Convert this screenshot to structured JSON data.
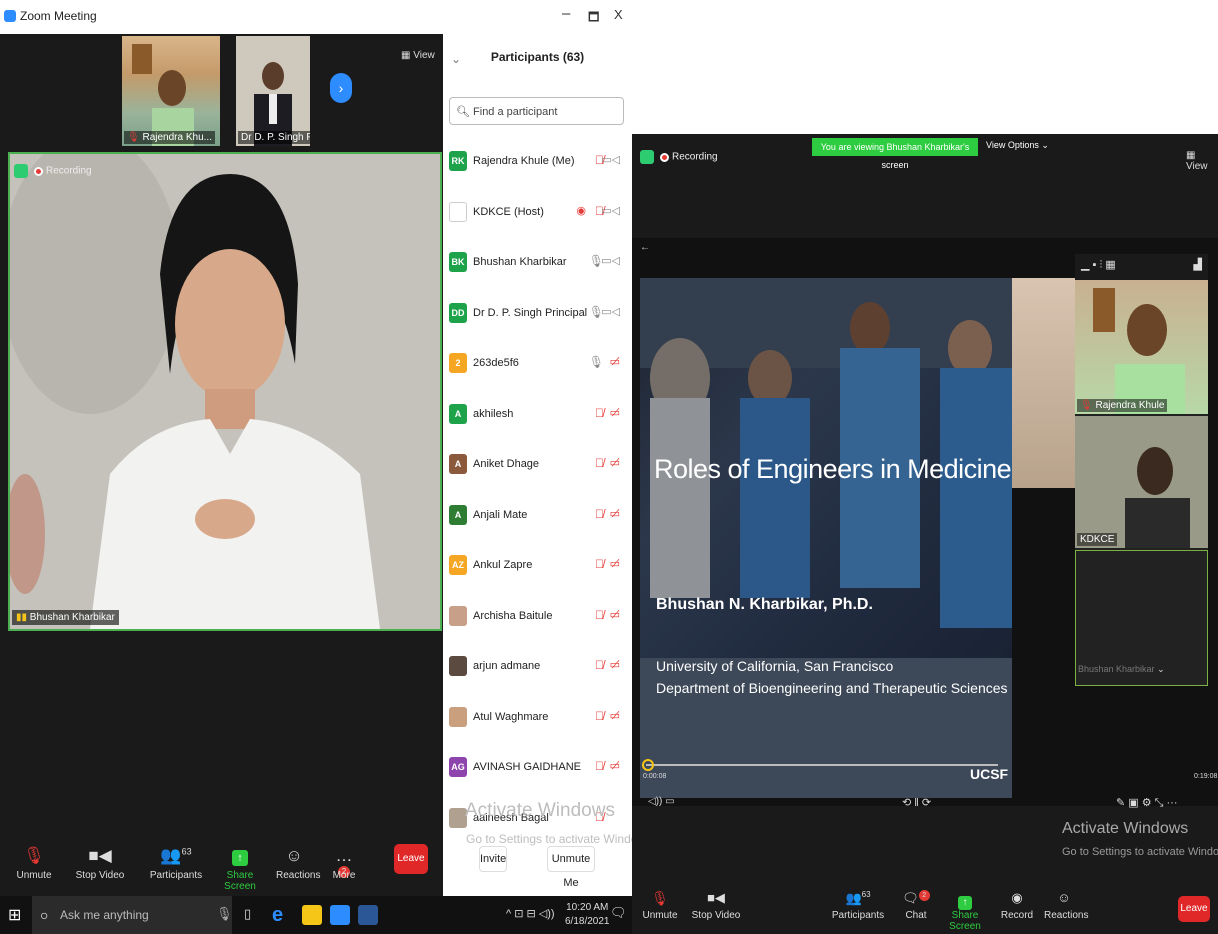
{
  "window": {
    "title": "Zoom Meeting",
    "minimize": "–",
    "maximize": "🗖",
    "close": "X"
  },
  "strip": {
    "thumbs": [
      {
        "label": "Rajendra Khu..."
      },
      {
        "label": "Dr D. P. Singh Pr..."
      }
    ],
    "next": "›",
    "view": "View"
  },
  "main_video": {
    "label": "Bhushan Kharbikar",
    "recording": "Recording"
  },
  "participants": {
    "header": "Participants (63)",
    "search_placeholder": "Find a participant",
    "rows": [
      {
        "initials": "RK",
        "color": "#1fa34a",
        "name": "Rajendra Khule (Me)",
        "mic": "muted",
        "cam": "on"
      },
      {
        "initials": "",
        "color": "#ffffff",
        "name": "KDKCE (Host)",
        "mic": "muted",
        "cam": "on",
        "rec": true
      },
      {
        "initials": "BK",
        "color": "#1fa34a",
        "name": "Bhushan Kharbikar",
        "mic": "on",
        "cam": "on"
      },
      {
        "initials": "DD",
        "color": "#1fa34a",
        "name": "Dr D. P. Singh Principal",
        "mic": "on",
        "cam": "on"
      },
      {
        "initials": "2",
        "color": "#f5a623",
        "name": "263de5f6",
        "mic": "on",
        "cam": "off"
      },
      {
        "initials": "A",
        "color": "#1fa34a",
        "name": "akhilesh",
        "mic": "muted",
        "cam": "off"
      },
      {
        "initials": "A",
        "color": "#8b5a3c",
        "name": "Aniket Dhage",
        "mic": "muted",
        "cam": "off"
      },
      {
        "initials": "A",
        "color": "#2e7d32",
        "name": "Anjali Mate",
        "mic": "muted",
        "cam": "off"
      },
      {
        "initials": "AZ",
        "color": "#f5a623",
        "name": "Ankul Zapre",
        "mic": "muted",
        "cam": "off"
      },
      {
        "initials": "",
        "color": "#c8a08a",
        "name": "Archisha Baitule",
        "mic": "muted",
        "cam": "off"
      },
      {
        "initials": "",
        "color": "#5a4a40",
        "name": "arjun admane",
        "mic": "muted",
        "cam": "off"
      },
      {
        "initials": "",
        "color": "#c99f7e",
        "name": "Atul Waghmare",
        "mic": "muted",
        "cam": "off"
      },
      {
        "initials": "AG",
        "color": "#8e44ad",
        "name": "AVINASH GAIDHANE",
        "mic": "muted",
        "cam": "off"
      },
      {
        "initials": "",
        "color": "#b0a090",
        "name": "aaineesh Bagal",
        "mic": "muted",
        "cam": ""
      }
    ],
    "invite": "Invite",
    "unmute_me": "Unmute Me"
  },
  "watermark": {
    "title": "Activate Windows",
    "subtitle": "Go to Settings to activate Windows."
  },
  "toolbar_left": {
    "unmute": "Unmute",
    "stop_video": "Stop Video",
    "participants": "Participants",
    "participant_count": "63",
    "share_screen": "Share Screen",
    "reactions": "Reactions",
    "more": "More",
    "more_badge": "2",
    "leave": "Leave"
  },
  "taskbar": {
    "search": "Ask me anything",
    "time": "10:20 AM",
    "date": "6/18/2021",
    "notif": "1"
  },
  "right": {
    "recording": "Recording",
    "viewing_banner": "You are viewing Bhushan Kharbikar's screen",
    "view_options": "View Options ⌄",
    "view": "View",
    "back": "←",
    "slide": {
      "title": "Roles of Engineers in Medicine",
      "author": "Bhushan N. Kharbikar, Ph.D.",
      "affil1": "University of California, San Francisco",
      "affil2": "Department of Bioengineering and Therapeutic Sciences",
      "logo": "UCSF"
    },
    "time_start": "0:00:08",
    "time_end": "0:19:08",
    "side_labels": {
      "a": "Rajendra Khule",
      "b": "KDKCE",
      "c": "Bhushan Kharbikar"
    },
    "toolbar": {
      "unmute": "Unmute",
      "stop_video": "Stop Video",
      "participants": "Participants",
      "participant_count": "63",
      "chat": "Chat",
      "chat_badge": "2",
      "share_screen": "Share Screen",
      "record": "Record",
      "reactions": "Reactions",
      "leave": "Leave"
    }
  }
}
